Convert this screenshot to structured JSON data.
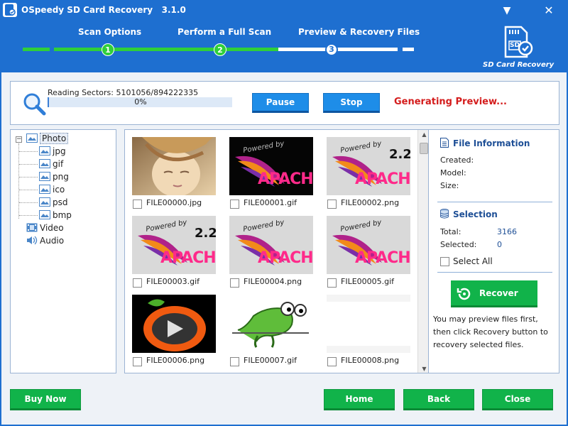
{
  "window": {
    "title": "OSpeedy SD Card Recovery   3.1.0",
    "minimize_glyph": "▼",
    "close_glyph": "✕"
  },
  "steps": [
    {
      "label": "Scan Options",
      "number": "1",
      "state": "done"
    },
    {
      "label": "Perform a Full Scan",
      "number": "2",
      "state": "done"
    },
    {
      "label": "Preview & Recovery Files",
      "number": "3",
      "state": "current"
    }
  ],
  "logo": {
    "text": "SD Card Recovery",
    "badge": "SD"
  },
  "scan": {
    "reading_label": "Reading Sectors: 5101056/894222335",
    "progress_percent": 0,
    "progress_text": "0%",
    "pause_label": "Pause",
    "stop_label": "Stop",
    "status_text": "Generating Preview..."
  },
  "tree": {
    "root": {
      "label": "Photo",
      "expander": "−"
    },
    "photo_children": [
      "jpg",
      "gif",
      "png",
      "ico",
      "psd",
      "bmp"
    ],
    "video": "Video",
    "audio": "Audio"
  },
  "files": [
    {
      "name": "FILE00000.jpg",
      "thumb": "face"
    },
    {
      "name": "FILE00001.gif",
      "thumb": "apache-dark"
    },
    {
      "name": "FILE00002.png",
      "thumb": "apache-22"
    },
    {
      "name": "FILE00003.gif",
      "thumb": "apache-22"
    },
    {
      "name": "FILE00004.png",
      "thumb": "apache-light"
    },
    {
      "name": "FILE00005.gif",
      "thumb": "apache-light"
    },
    {
      "name": "FILE00006.png",
      "thumb": "play-button"
    },
    {
      "name": "FILE00007.gif",
      "thumb": "chameleon"
    },
    {
      "name": "FILE00008.png",
      "thumb": "blank"
    }
  ],
  "apache": {
    "powered_by": "Powered by",
    "word": "APACHE",
    "version": "2.2"
  },
  "info": {
    "file_info_heading": "File Information",
    "created_label": "Created:",
    "model_label": "Model:",
    "size_label": "Size:",
    "selection_heading": "Selection",
    "total_label": "Total:",
    "total_value": "3166",
    "selected_label": "Selected:",
    "selected_value": "0",
    "select_all_label": "Select All",
    "recover_label": "Recover",
    "hint": "You may preview files first, then click Recovery button to recovery selected files."
  },
  "footer": {
    "buy_now": "Buy Now",
    "home": "Home",
    "back": "Back",
    "close": "Close"
  },
  "colors": {
    "header_blue": "#1e6fd0",
    "progress_green": "#2fcf3a",
    "button_green": "#11b34a",
    "button_blue": "#1e8de8",
    "status_red": "#d41c1c"
  }
}
